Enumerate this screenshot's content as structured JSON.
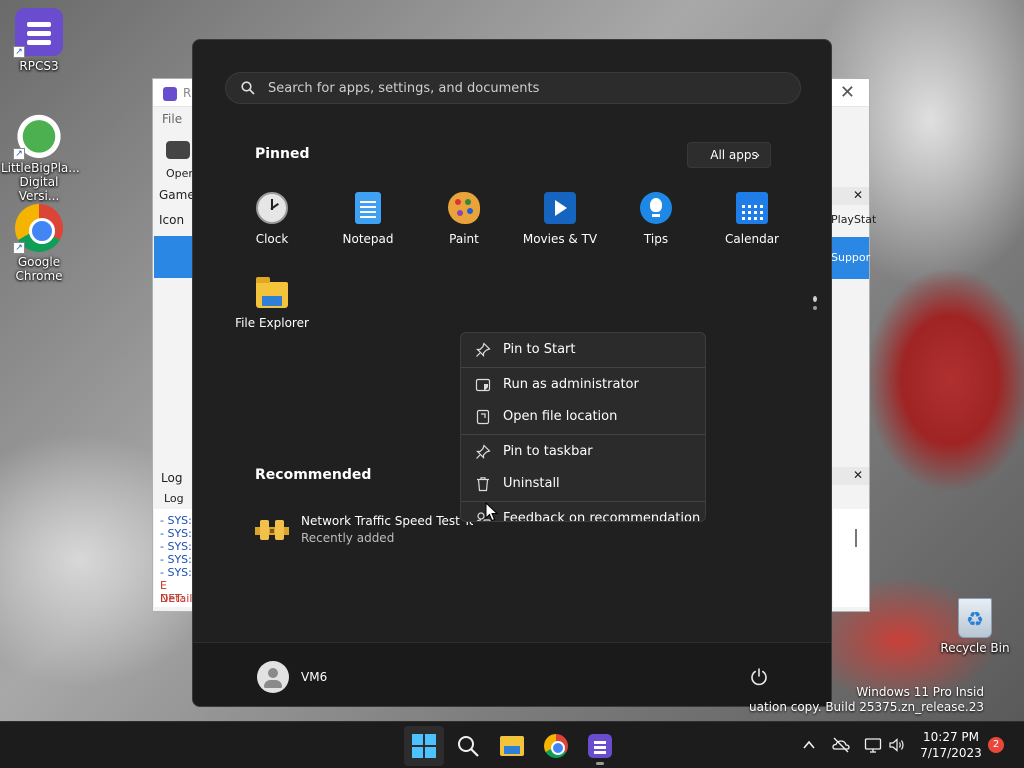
{
  "desktop": {
    "icons": [
      {
        "label": "RPCS3"
      },
      {
        "label_line1": "LittleBigPla...",
        "label_line2": "Digital Versi..."
      },
      {
        "label_line1": "Google",
        "label_line2": "Chrome"
      },
      {
        "label": "Recycle Bin"
      }
    ],
    "watermark_line1": "Windows 11 Pro Insid",
    "watermark_line2": "uation copy. Build 25375.zn_release.23"
  },
  "background_window": {
    "title": "R",
    "menu_file": "File",
    "toolbar_open": "Oper",
    "col_game": "Game",
    "col_icon": "Icon",
    "right_col_playstation": "PlayStat",
    "right_row_support": "Suppor",
    "log_panel_title": "Log",
    "log_tab": "Log",
    "log_lines": [
      "- SYS:",
      "- SYS:",
      "- SYS:",
      "- SYS:",
      "- SYS:",
      "E NET:",
      "Details"
    ]
  },
  "start_menu": {
    "search": {
      "placeholder": "Search for apps, settings, and documents"
    },
    "pinned_title": "Pinned",
    "all_apps_label": "All apps",
    "pinned_apps": [
      {
        "label": "Clock",
        "icon": "clock-icon"
      },
      {
        "label": "Notepad",
        "icon": "notepad-icon"
      },
      {
        "label": "Paint",
        "icon": "paint-icon"
      },
      {
        "label": "Movies & TV",
        "icon": "movies-tv-icon"
      },
      {
        "label": "Tips",
        "icon": "tips-icon"
      },
      {
        "label": "Calendar",
        "icon": "calendar-icon"
      },
      {
        "label": "File Explorer",
        "icon": "file-explorer-icon"
      }
    ],
    "recommended_title": "Recommended",
    "recommended": [
      {
        "title": "Network Traffic Speed Test To...",
        "subtitle": "Recently added"
      }
    ],
    "user_name": "VM6"
  },
  "context_menu": {
    "items": [
      {
        "label": "Pin to Start",
        "icon": "pin-icon"
      },
      {
        "label": "Run as administrator",
        "icon": "admin-shield-icon"
      },
      {
        "label": "Open file location",
        "icon": "folder-open-icon"
      },
      {
        "label": "Pin to taskbar",
        "icon": "pin-icon"
      },
      {
        "label": "Uninstall",
        "icon": "trash-icon"
      },
      {
        "label": "Feedback on recommendation",
        "icon": "feedback-icon"
      }
    ]
  },
  "taskbar": {
    "apps": [
      "start-icon",
      "search-icon",
      "file-explorer-icon",
      "chrome-icon",
      "rpcs3-icon"
    ],
    "time": "10:27 PM",
    "date": "7/17/2023",
    "notification_count": "2"
  },
  "colors": {
    "start_bg": "#202020",
    "accent": "#4cc2ff",
    "taskbar_bg": "#1c1c1c"
  }
}
